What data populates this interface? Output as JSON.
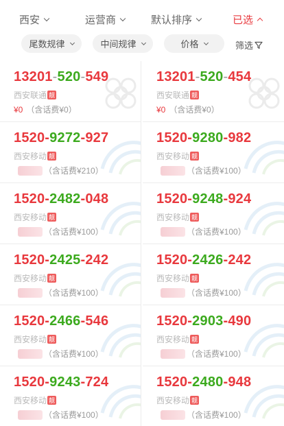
{
  "tabs": [
    {
      "label": "西安",
      "active": false
    },
    {
      "label": "运营商",
      "active": false
    },
    {
      "label": "默认排序",
      "active": false
    },
    {
      "label": "已选",
      "active": true
    }
  ],
  "filters": [
    {
      "label": "尾数规律"
    },
    {
      "label": "中间规律"
    },
    {
      "label": "价格"
    }
  ],
  "screen_label": "筛选",
  "colors": {
    "accent_red": "#e8383d",
    "green": "#3caa1e",
    "muted": "#999999"
  },
  "numbers": [
    {
      "parts": [
        "13201",
        "-",
        "520",
        "-",
        "549"
      ],
      "carrier": "西安联通",
      "badge": "靓",
      "price_value": "¥0",
      "price_note": "（含话费¥0）",
      "price_hidden": false,
      "watermark": "unicom"
    },
    {
      "parts": [
        "13201",
        "-",
        "520",
        "-",
        "454"
      ],
      "carrier": "西安联通",
      "badge": "靓",
      "price_value": "¥0",
      "price_note": "（含话费¥0）",
      "price_hidden": false,
      "watermark": "unicom"
    },
    {
      "parts": [
        "1520",
        "-",
        "9272",
        "-",
        "927"
      ],
      "carrier": "西安移动",
      "badge": "靓",
      "price_value": "",
      "price_note": "（含话费¥210）",
      "price_hidden": true,
      "watermark": "mobile"
    },
    {
      "parts": [
        "1520",
        "-",
        "9280",
        "-",
        "982"
      ],
      "carrier": "西安移动",
      "badge": "靓",
      "price_value": "",
      "price_note": "（含话费¥100）",
      "price_hidden": true,
      "watermark": "mobile"
    },
    {
      "parts": [
        "1520",
        "-",
        "2482",
        "-",
        "048"
      ],
      "carrier": "西安移动",
      "badge": "靓",
      "price_value": "",
      "price_note": "（含话费¥100）",
      "price_hidden": true,
      "watermark": "mobile"
    },
    {
      "parts": [
        "1520",
        "-",
        "9248",
        "-",
        "924"
      ],
      "carrier": "西安移动",
      "badge": "靓",
      "price_value": "",
      "price_note": "（含话费¥100）",
      "price_hidden": true,
      "watermark": "mobile"
    },
    {
      "parts": [
        "1520",
        "-",
        "2425",
        "-",
        "242"
      ],
      "carrier": "西安移动",
      "badge": "靓",
      "price_value": "",
      "price_note": "（含话费¥100）",
      "price_hidden": true,
      "watermark": "mobile"
    },
    {
      "parts": [
        "1520",
        "-",
        "2426",
        "-",
        "242"
      ],
      "carrier": "西安移动",
      "badge": "靓",
      "price_value": "",
      "price_note": "（含话费¥100）",
      "price_hidden": true,
      "watermark": "mobile"
    },
    {
      "parts": [
        "1520",
        "-",
        "2466",
        "-",
        "546"
      ],
      "carrier": "西安移动",
      "badge": "靓",
      "price_value": "",
      "price_note": "（含话费¥100）",
      "price_hidden": true,
      "watermark": "mobile"
    },
    {
      "parts": [
        "1520",
        "-",
        "2903",
        "-",
        "490"
      ],
      "carrier": "西安移动",
      "badge": "靓",
      "price_value": "",
      "price_note": "（含话费¥100）",
      "price_hidden": true,
      "watermark": "mobile"
    },
    {
      "parts": [
        "1520",
        "-",
        "9243",
        "-",
        "724"
      ],
      "carrier": "西安移动",
      "badge": "靓",
      "price_value": "",
      "price_note": "（含话费¥100）",
      "price_hidden": true,
      "watermark": "mobile"
    },
    {
      "parts": [
        "1520",
        "-",
        "2480",
        "-",
        "948"
      ],
      "carrier": "西安移动",
      "badge": "靓",
      "price_value": "",
      "price_note": "（含话费¥100）",
      "price_hidden": true,
      "watermark": "mobile"
    }
  ]
}
